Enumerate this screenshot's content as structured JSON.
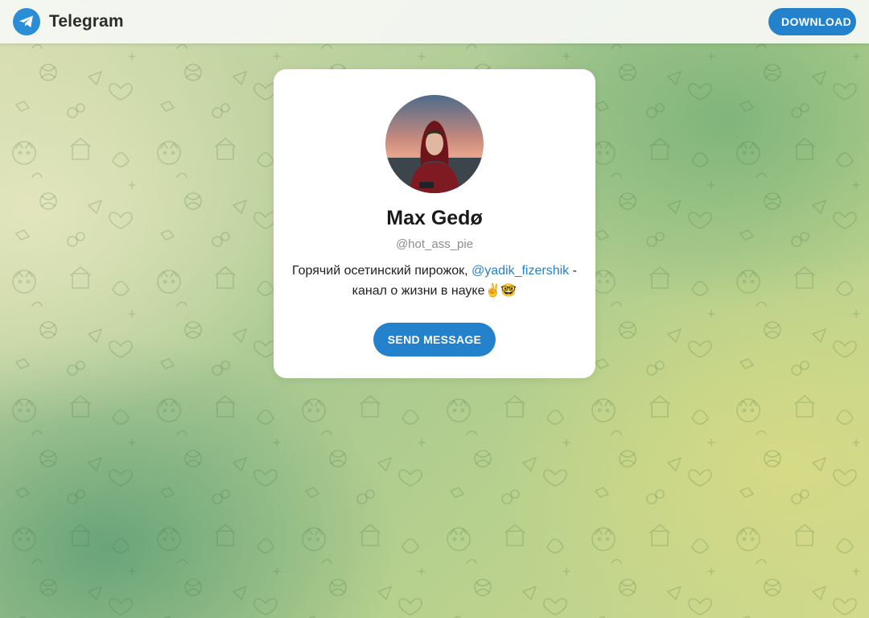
{
  "header": {
    "brand_name": "Telegram",
    "download_label": "DOWNLOAD"
  },
  "profile": {
    "name": "Max Gedø",
    "username": "@hot_ass_pie",
    "bio_before": "Горячий осетинский пирожок, ",
    "bio_link": "@yadik_fizershik",
    "bio_after": " - канал о жизни в науке✌️🤓",
    "send_label": "SEND MESSAGE"
  },
  "icons": {
    "logo": "telegram-plane-icon",
    "avatar": "profile-photo"
  },
  "colors": {
    "accent": "#2481cc",
    "brand_logo": "#2a8dd6",
    "username": "#8d8d8d",
    "card": "#ffffff"
  }
}
